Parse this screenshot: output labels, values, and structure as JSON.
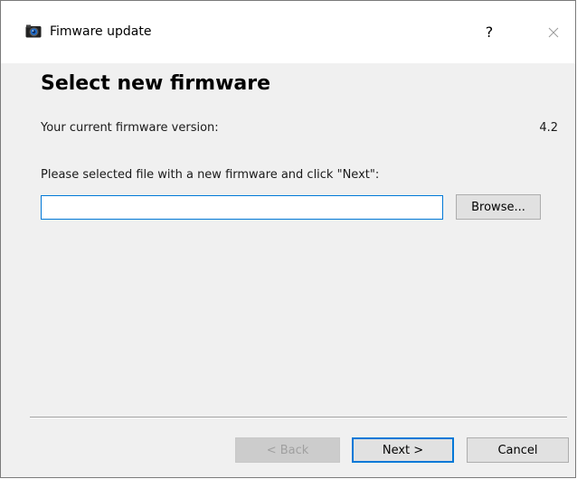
{
  "window": {
    "title": "Fimware update",
    "help_label": "?",
    "icons": {
      "app": "camera-icon",
      "close": "close-icon"
    }
  },
  "page": {
    "heading": "Select new firmware",
    "current_version_label": "Your current firmware version:",
    "current_version_value": "4.2",
    "instruction": "Please selected file with a new firmware and click \"Next\":",
    "file_input_value": "",
    "file_input_placeholder": "",
    "browse_label": "Browse..."
  },
  "footer": {
    "back_label": "< Back",
    "next_label": "Next >",
    "cancel_label": "Cancel"
  },
  "colors": {
    "accent": "#0078d7",
    "dialog_background": "#f0f0f0"
  }
}
